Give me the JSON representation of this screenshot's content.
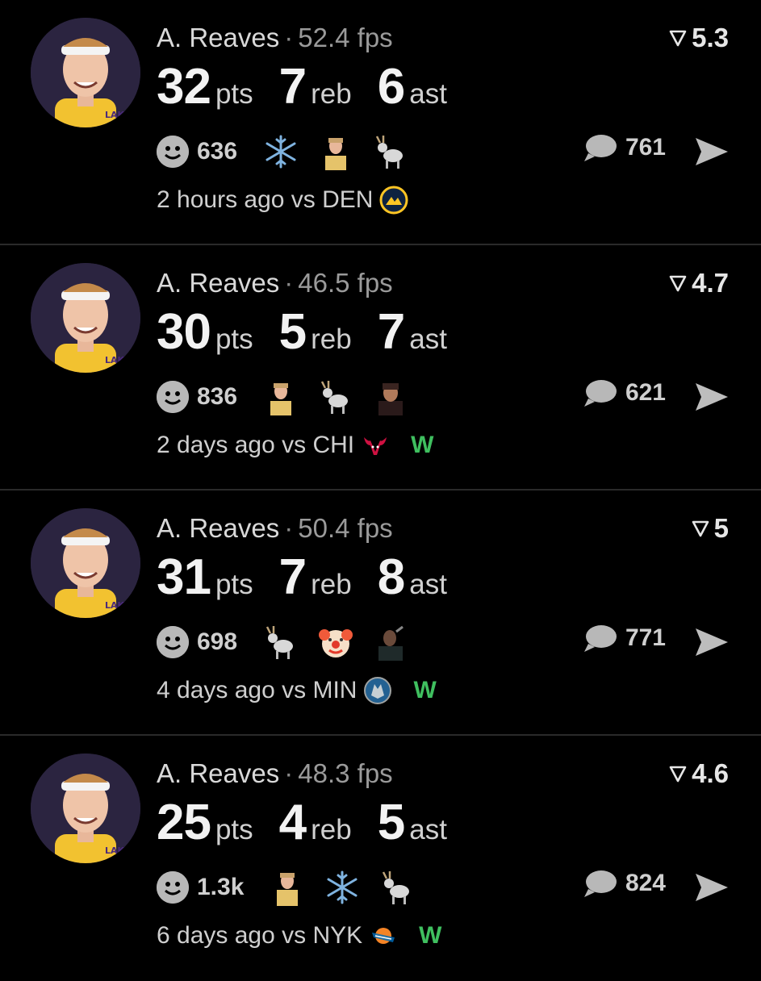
{
  "colors": {
    "background": "#000000",
    "win": "#3fbf5f",
    "divider": "#2a2a2a"
  },
  "cards": [
    {
      "player": "A. Reaves",
      "fps": "52.4 fps",
      "rating": "5.3",
      "pts": "32",
      "reb": "7",
      "ast": "6",
      "pts_label": "pts",
      "reb_label": "reb",
      "ast_label": "ast",
      "reaction_count": "636",
      "reaction_icons": [
        "snowflake-icon",
        "player-photo-icon",
        "goat-icon"
      ],
      "comment_count": "761",
      "time": "2 hours ago vs DEN",
      "team_icon": "nuggets-logo-icon",
      "result": ""
    },
    {
      "player": "A. Reaves",
      "fps": "46.5 fps",
      "rating": "4.7",
      "pts": "30",
      "reb": "5",
      "ast": "7",
      "pts_label": "pts",
      "reb_label": "reb",
      "ast_label": "ast",
      "reaction_count": "836",
      "reaction_icons": [
        "player-photo-icon",
        "goat-icon",
        "player-photo-icon"
      ],
      "comment_count": "621",
      "time": "2 days ago vs CHI",
      "team_icon": "bulls-logo-icon",
      "result": "W"
    },
    {
      "player": "A. Reaves",
      "fps": "50.4 fps",
      "rating": "5",
      "pts": "31",
      "reb": "7",
      "ast": "8",
      "pts_label": "pts",
      "reb_label": "reb",
      "ast_label": "ast",
      "reaction_count": "698",
      "reaction_icons": [
        "goat-icon",
        "clown-icon",
        "player-photo-icon"
      ],
      "comment_count": "771",
      "time": "4 days ago vs MIN",
      "team_icon": "timberwolves-logo-icon",
      "result": "W"
    },
    {
      "player": "A. Reaves",
      "fps": "48.3 fps",
      "rating": "4.6",
      "pts": "25",
      "reb": "4",
      "ast": "5",
      "pts_label": "pts",
      "reb_label": "reb",
      "ast_label": "ast",
      "reaction_count": "1.3k",
      "reaction_icons": [
        "player-photo-icon",
        "snowflake-icon",
        "goat-icon"
      ],
      "comment_count": "824",
      "time": "6 days ago vs NYK",
      "team_icon": "knicks-logo-icon",
      "result": "W"
    }
  ]
}
